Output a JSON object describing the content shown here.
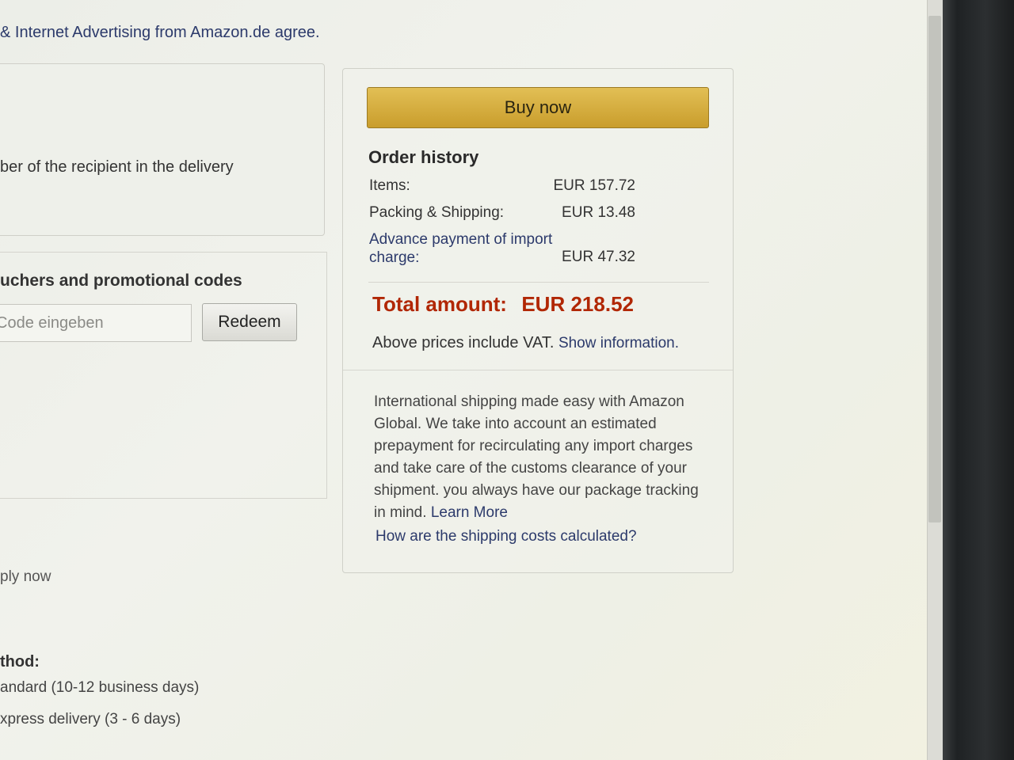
{
  "header": {
    "consent_text": "& Internet Advertising from Amazon.de agree."
  },
  "address": {
    "recipient_note": "ber of the recipient in the delivery"
  },
  "vouchers": {
    "title": "uchers and promotional codes",
    "input_placeholder": "Code eingeben",
    "redeem_label": "Redeem"
  },
  "payment": {
    "apply_now": "ply now"
  },
  "shipping_method": {
    "label": "thod:",
    "options": [
      "andard (10-12 business days)",
      "xpress delivery (3 - 6 days)"
    ]
  },
  "summary": {
    "buy_now_label": "Buy now",
    "title": "Order history",
    "rows": [
      {
        "label": "Items:",
        "value": "EUR 157.72"
      },
      {
        "label": "Packing & Shipping:",
        "value": "EUR 13.48"
      },
      {
        "label": "Advance payment of import charge:",
        "value": "EUR 47.32"
      }
    ],
    "total_label": "Total amount:",
    "total_value": "EUR 218.52",
    "vat_text": "Above prices include VAT.",
    "vat_link": "Show information.",
    "global_text": "International shipping made easy with Amazon Global. We take into account an estimated prepayment for recirculating any import charges and take care of the customs clearance of your shipment. you always have our package tracking in mind.",
    "learn_more": "Learn More",
    "shipping_costs_link": "How are the shipping costs calculated?"
  },
  "colors": {
    "total_red": "#b12704",
    "link_blue": "#2c3a6b",
    "buy_button": "#d6ae3f"
  }
}
